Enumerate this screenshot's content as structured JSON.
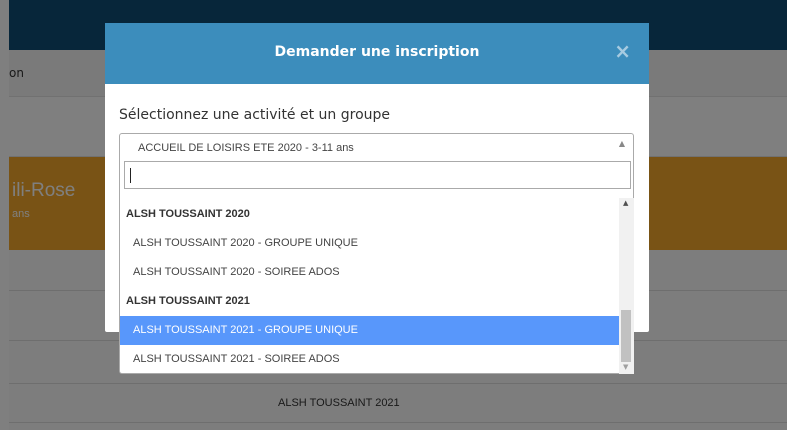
{
  "background": {
    "row1_text": "on",
    "banner_name": "ili-Rose",
    "banner_sub": "ans",
    "group_text": "ALSH TOUSSAINT 2021"
  },
  "modal": {
    "title": "Demander une inscription",
    "close_icon": "×",
    "label": "Sélectionnez une activité et un groupe"
  },
  "select": {
    "value": "ACCUEIL DE LOISIRS ETE 2020 - 3-11 ans",
    "arrow_icon": "▲"
  },
  "dropdown": {
    "search_value": "",
    "items": [
      {
        "type": "group",
        "label": "ALSH TOUSSAINT 2020"
      },
      {
        "type": "option",
        "label": "ALSH TOUSSAINT 2020 - GROUPE UNIQUE"
      },
      {
        "type": "option",
        "label": "ALSH TOUSSAINT 2020 - SOIREE ADOS"
      },
      {
        "type": "group",
        "label": "ALSH TOUSSAINT 2021"
      },
      {
        "type": "option",
        "label": "ALSH TOUSSAINT 2021 - GROUPE UNIQUE",
        "highlighted": true
      },
      {
        "type": "option",
        "label": "ALSH TOUSSAINT 2021 - SOIREE ADOS"
      }
    ],
    "scroll_up_icon": "▲",
    "scroll_down_icon": "▼"
  },
  "colors": {
    "header_blue": "#3c8dbc",
    "navbar": "#0f4d75",
    "banner_orange": "#f2a72a",
    "highlight": "#5897fb"
  }
}
